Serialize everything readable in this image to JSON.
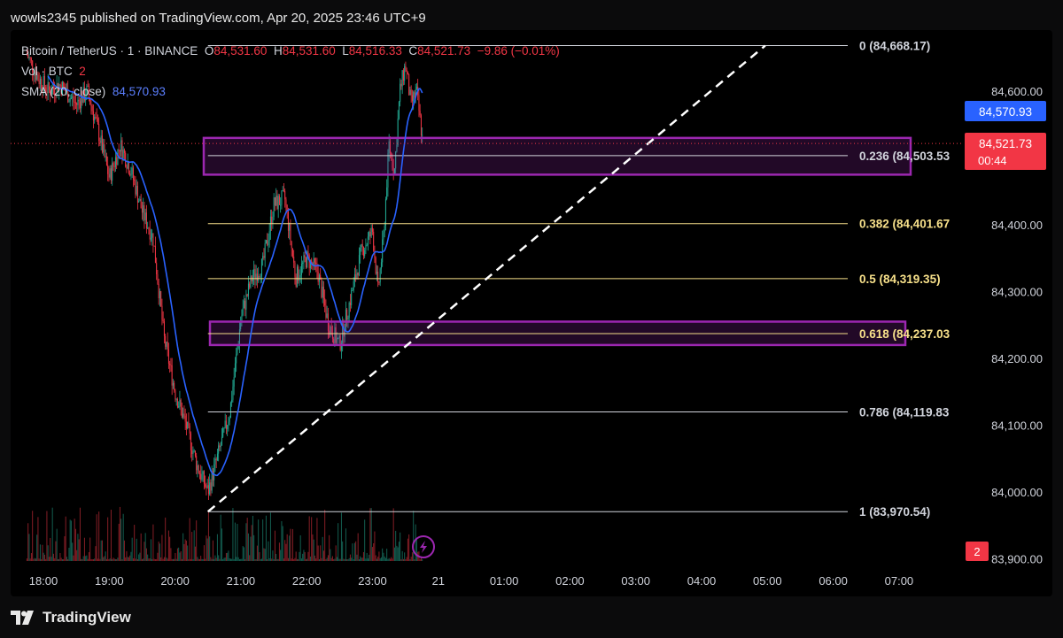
{
  "header": {
    "published_text": "wowls2345 published on TradingView.com, Apr 20, 2025 23:46 UTC+9"
  },
  "footer": {
    "brand": "TradingView"
  },
  "legend": {
    "symbol": "Bitcoin / TetherUS · 1 · BINANCE",
    "o_label": "O",
    "o_value": "84,531.60",
    "h_label": "H",
    "h_value": "84,531.60",
    "l_label": "L",
    "l_value": "84,516.33",
    "c_label": "C",
    "c_value": "84,521.73",
    "change": "−9.86 (−0.01%)",
    "vol_label": "Vol · BTC",
    "vol_value": "2",
    "sma_label": "SMA (20, close)",
    "sma_value": "84,570.93"
  },
  "colors": {
    "bull": "#22ab94",
    "bear": "#f23645",
    "sma": "#2962ff",
    "fib_white": "#d1d4dc",
    "fib_yellow": "#f7e08a",
    "zone": "#9c27b0",
    "sma_badge": "#2962ff",
    "price_badge": "#f23645"
  },
  "price_badges": {
    "sma": "84,570.93",
    "last": "84,521.73",
    "countdown": "00:44",
    "volume": "2"
  },
  "chart_data": {
    "type": "candlestick",
    "symbol": "BTCUSDT",
    "interval": "1",
    "y_axis_ticks": [
      "84,600.00",
      "84,400.00",
      "84,300.00",
      "84,200.00",
      "84,100.00",
      "84,000.00",
      "83,900.00"
    ],
    "y_axis_tick_values": [
      84600,
      84400,
      84300,
      84200,
      84100,
      84000,
      83900
    ],
    "x_axis_ticks": [
      "18:00",
      "19:00",
      "20:00",
      "21:00",
      "22:00",
      "23:00",
      "21",
      "01:00",
      "02:00",
      "03:00",
      "04:00",
      "05:00",
      "06:00",
      "07:00"
    ],
    "ylim": [
      83900,
      84668.17
    ],
    "fib_retracement": [
      {
        "level": "0",
        "price": "84,668.17",
        "value": 84668.17,
        "label": "0 (84,668.17)",
        "color": "white"
      },
      {
        "level": "0.236",
        "price": "84,503.53",
        "value": 84503.53,
        "label": "0.236 (84,503.53",
        "color": "white"
      },
      {
        "level": "0.382",
        "price": "84,401.67",
        "value": 84401.67,
        "label": "0.382 (84,401.67",
        "color": "yellow"
      },
      {
        "level": "0.5",
        "price": "84,319.35",
        "value": 84319.35,
        "label": "0.5 (84,319.35)",
        "color": "yellow"
      },
      {
        "level": "0.618",
        "price": "84,237.03",
        "value": 84237.03,
        "label": "0.618 (84,237.03",
        "color": "yellow"
      },
      {
        "level": "0.786",
        "price": "84,119.83",
        "value": 84119.83,
        "label": "0.786 (84,119.83",
        "color": "white"
      },
      {
        "level": "1",
        "price": "83,970.54",
        "value": 83970.54,
        "label": "1 (83,970.54)",
        "color": "white"
      }
    ],
    "zones": [
      {
        "name": "upper-zone",
        "top": 84530,
        "bottom": 84475
      },
      {
        "name": "lower-zone",
        "top": 84255,
        "bottom": 84220
      }
    ],
    "trend_from": {
      "time": "20:30",
      "value": 83970.54
    },
    "trend_to": {
      "time": "04:58",
      "value": 84668.17
    },
    "price_path": [
      {
        "t": "17:45",
        "v": 84655
      },
      {
        "t": "17:55",
        "v": 84620
      },
      {
        "t": "18:05",
        "v": 84600
      },
      {
        "t": "18:15",
        "v": 84610
      },
      {
        "t": "18:30",
        "v": 84580
      },
      {
        "t": "18:40",
        "v": 84600
      },
      {
        "t": "18:50",
        "v": 84540
      },
      {
        "t": "19:00",
        "v": 84470
      },
      {
        "t": "19:10",
        "v": 84520
      },
      {
        "t": "19:20",
        "v": 84480
      },
      {
        "t": "19:30",
        "v": 84420
      },
      {
        "t": "19:40",
        "v": 84380
      },
      {
        "t": "19:50",
        "v": 84230
      },
      {
        "t": "20:00",
        "v": 84150
      },
      {
        "t": "20:10",
        "v": 84100
      },
      {
        "t": "20:20",
        "v": 84040
      },
      {
        "t": "20:30",
        "v": 84000
      },
      {
        "t": "20:40",
        "v": 84060
      },
      {
        "t": "20:50",
        "v": 84120
      },
      {
        "t": "21:00",
        "v": 84260
      },
      {
        "t": "21:10",
        "v": 84320
      },
      {
        "t": "21:20",
        "v": 84340
      },
      {
        "t": "21:30",
        "v": 84430
      },
      {
        "t": "21:40",
        "v": 84440
      },
      {
        "t": "21:50",
        "v": 84320
      },
      {
        "t": "22:00",
        "v": 84350
      },
      {
        "t": "22:10",
        "v": 84330
      },
      {
        "t": "22:20",
        "v": 84250
      },
      {
        "t": "22:30",
        "v": 84220
      },
      {
        "t": "22:40",
        "v": 84290
      },
      {
        "t": "22:50",
        "v": 84360
      },
      {
        "t": "23:00",
        "v": 84390
      },
      {
        "t": "23:05",
        "v": 84300
      },
      {
        "t": "23:10",
        "v": 84380
      },
      {
        "t": "23:15",
        "v": 84520
      },
      {
        "t": "23:20",
        "v": 84480
      },
      {
        "t": "23:25",
        "v": 84600
      },
      {
        "t": "23:30",
        "v": 84640
      },
      {
        "t": "23:35",
        "v": 84580
      },
      {
        "t": "23:40",
        "v": 84600
      },
      {
        "t": "23:46",
        "v": 84521.73
      }
    ]
  }
}
